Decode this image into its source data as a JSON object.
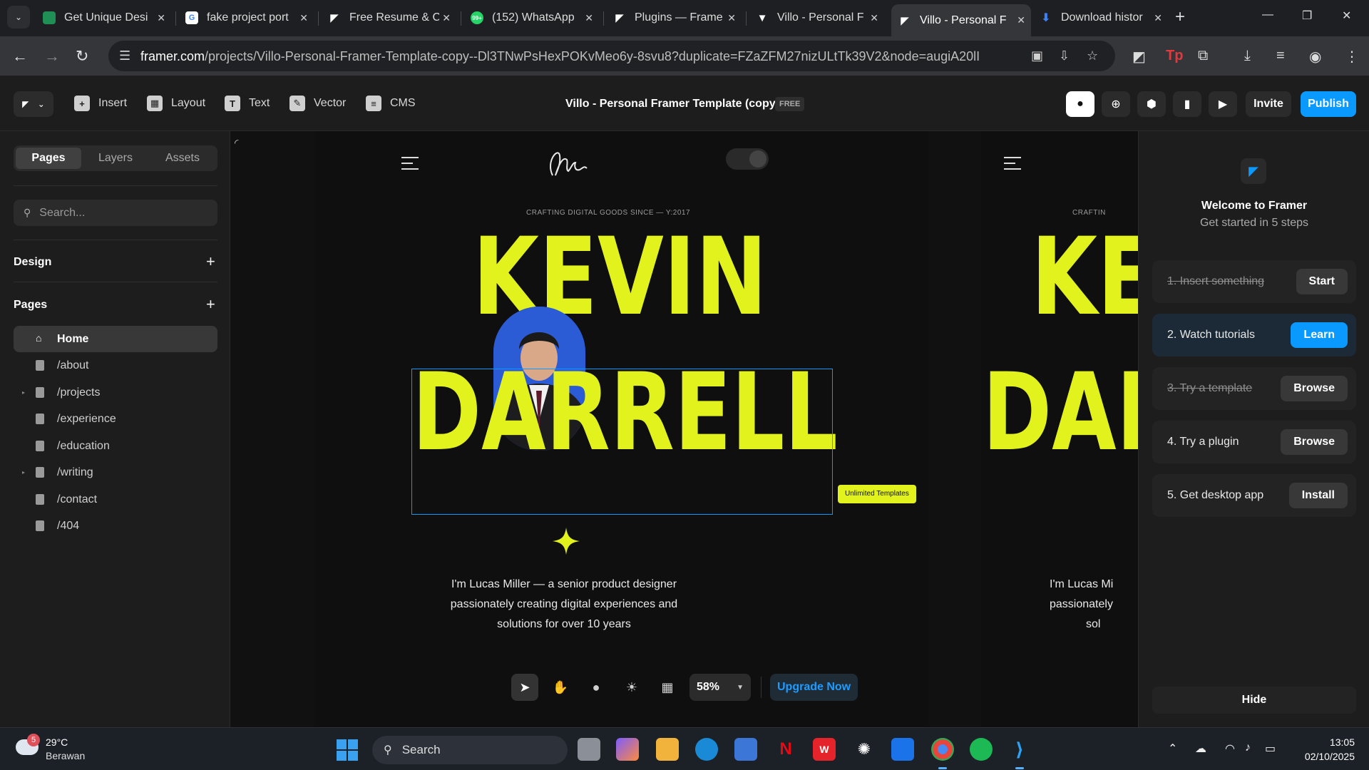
{
  "browser": {
    "tabs": [
      {
        "title": "Get Unique Desi",
        "favicon": "docs-icon",
        "color": "#1f8f55"
      },
      {
        "title": "fake project port",
        "favicon": "google-icon",
        "color": "#ffffff"
      },
      {
        "title": "Free Resume & C",
        "favicon": "framer-icon",
        "color": "#ffffff"
      },
      {
        "title": "(152) WhatsApp",
        "favicon": "whatsapp-icon",
        "color": "#25d366",
        "badge": "99+"
      },
      {
        "title": "Plugins — Frame",
        "favicon": "framer-icon",
        "color": "#ffffff"
      },
      {
        "title": "Villo - Personal F",
        "favicon": "villo-icon",
        "color": "#ffffff"
      },
      {
        "title": "Villo - Personal F",
        "favicon": "framer-icon",
        "color": "#ffffff",
        "active": true
      },
      {
        "title": "Download histor",
        "favicon": "download-icon",
        "color": "#3b82f6"
      }
    ],
    "url_host": "framer.com",
    "url_path": "/projects/Villo-Personal-Framer-Template-copy--Dl3TNwPsHexPOKvMeo6y-8svu8?duplicate=FZaZFM27nizULtTk39V2&node=augiA20lI"
  },
  "toolbar": {
    "insert": "Insert",
    "layout": "Layout",
    "text": "Text",
    "vector": "Vector",
    "cms": "CMS",
    "project_title": "Villo - Personal Framer Template (copy)",
    "plan_badge": "FREE",
    "invite": "Invite",
    "publish": "Publish"
  },
  "left_panel": {
    "tabs": [
      "Pages",
      "Layers",
      "Assets"
    ],
    "active_tab": "Pages",
    "search_placeholder": "Search...",
    "design_heading": "Design",
    "pages_heading": "Pages",
    "pages": [
      {
        "label": "Home",
        "active": true,
        "icon": "home-icon"
      },
      {
        "label": "/about"
      },
      {
        "label": "/projects",
        "expandable": true
      },
      {
        "label": "/experience"
      },
      {
        "label": "/education"
      },
      {
        "label": "/writing",
        "expandable": true
      },
      {
        "label": "/contact"
      },
      {
        "label": "/404"
      }
    ]
  },
  "canvas": {
    "crafting": "CRAFTING DIGITAL GOODS SINCE — Y:2017",
    "crafting_clip": "CRAFTIN",
    "first_name": "KEVIN",
    "last_name": "DARRELL",
    "first_name_clip": "KE",
    "last_name_clip": "DAI",
    "badge": "Unlimited Templates",
    "bio_lines": [
      "I'm Lucas Miller — a senior product designer",
      "passionately creating digital experiences and",
      "solutions for over 10 years"
    ],
    "bio_clip": [
      "I'm Lucas Mi",
      "passionately",
      "sol"
    ],
    "accent": "#e2f21d",
    "zoom": "58%",
    "upgrade": "Upgrade Now"
  },
  "welcome": {
    "title": "Welcome to Framer",
    "subtitle": "Get started in 5 steps",
    "steps": [
      {
        "label": "1.   Insert something",
        "button": "Start",
        "done": true
      },
      {
        "label": "2.   Watch tutorials",
        "button": "Learn",
        "highlight": true
      },
      {
        "label": "3.   Try a template",
        "button": "Browse",
        "done": true
      },
      {
        "label": "4.   Try a plugin",
        "button": "Browse"
      },
      {
        "label": "5.   Get desktop app",
        "button": "Install"
      }
    ],
    "hide": "Hide"
  },
  "taskbar": {
    "temperature": "29°C",
    "condition": "Berawan",
    "notification_count": "5",
    "search": "Search",
    "time": "13:05",
    "date": "02/10/2025"
  }
}
